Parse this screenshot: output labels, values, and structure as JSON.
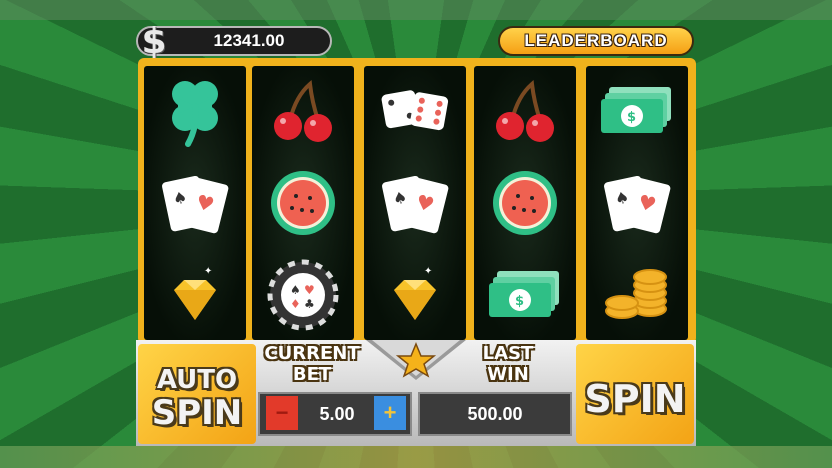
{
  "header": {
    "currency_symbol": "$",
    "balance": "12341.00",
    "leaderboard_label": "LEADERBOARD"
  },
  "reels": [
    {
      "symbols": [
        "clover-icon",
        "cards-icon",
        "diamond-icon"
      ]
    },
    {
      "symbols": [
        "cherries-icon",
        "watermelon-icon",
        "poker-chip-icon"
      ]
    },
    {
      "symbols": [
        "dice-icon",
        "cards-icon",
        "diamond-icon"
      ]
    },
    {
      "symbols": [
        "cherries-icon",
        "watermelon-icon",
        "cash-icon"
      ]
    },
    {
      "symbols": [
        "cash-icon",
        "cards-icon",
        "coins-icon"
      ]
    }
  ],
  "controls": {
    "auto_spin_line1": "AUTO",
    "auto_spin_line2": "SPIN",
    "current_bet_line1": "CURRENT",
    "current_bet_line2": "BET",
    "bet_minus": "−",
    "bet_value": "5.00",
    "bet_plus": "+",
    "last_win_line1": "LAST",
    "last_win_line2": "WIN",
    "last_win_value": "500.00",
    "spin_label": "SPIN"
  },
  "colors": {
    "gold": "#f3a315",
    "felt_green": "#1f6e2d",
    "minus_red": "#e23a2a",
    "plus_blue": "#3a8ee0"
  }
}
